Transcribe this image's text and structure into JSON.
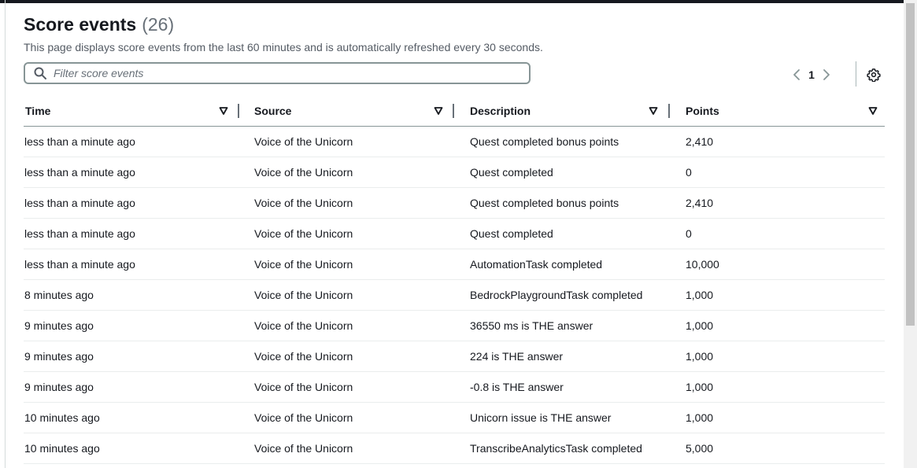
{
  "header": {
    "title": "Score events",
    "count": "(26)",
    "description": "This page displays score events from the last 60 minutes and is automatically refreshed every 30 seconds."
  },
  "filter": {
    "placeholder": "Filter score events",
    "value": ""
  },
  "pagination": {
    "current_page": "1"
  },
  "icons": {
    "search": "search-icon",
    "prev": "chevron-left-icon",
    "next": "chevron-right-icon",
    "settings": "gear-icon",
    "sort": "sort-caret-down-icon"
  },
  "table": {
    "columns": [
      "Time",
      "Source",
      "Description",
      "Points"
    ],
    "rows": [
      {
        "time": "less than a minute ago",
        "source": "Voice of the Unicorn",
        "description": "Quest completed bonus points",
        "points": "2,410"
      },
      {
        "time": "less than a minute ago",
        "source": "Voice of the Unicorn",
        "description": "Quest completed",
        "points": "0"
      },
      {
        "time": "less than a minute ago",
        "source": "Voice of the Unicorn",
        "description": "Quest completed bonus points",
        "points": "2,410"
      },
      {
        "time": "less than a minute ago",
        "source": "Voice of the Unicorn",
        "description": "Quest completed",
        "points": "0"
      },
      {
        "time": "less than a minute ago",
        "source": "Voice of the Unicorn",
        "description": "AutomationTask completed",
        "points": "10,000"
      },
      {
        "time": "8 minutes ago",
        "source": "Voice of the Unicorn",
        "description": "BedrockPlaygroundTask completed",
        "points": "1,000"
      },
      {
        "time": "9 minutes ago",
        "source": "Voice of the Unicorn",
        "description": "36550 ms is THE answer",
        "points": "1,000"
      },
      {
        "time": "9 minutes ago",
        "source": "Voice of the Unicorn",
        "description": "224 is THE answer",
        "points": "1,000"
      },
      {
        "time": "9 minutes ago",
        "source": "Voice of the Unicorn",
        "description": "-0.8 is THE answer",
        "points": "1,000"
      },
      {
        "time": "10 minutes ago",
        "source": "Voice of the Unicorn",
        "description": "Unicorn issue is THE answer",
        "points": "1,000"
      },
      {
        "time": "10 minutes ago",
        "source": "Voice of the Unicorn",
        "description": "TranscribeAnalyticsTask completed",
        "points": "5,000"
      }
    ]
  },
  "colors": {
    "text": "#16191f",
    "muted": "#545b64",
    "border": "#879596",
    "topbar": "#16191f"
  }
}
